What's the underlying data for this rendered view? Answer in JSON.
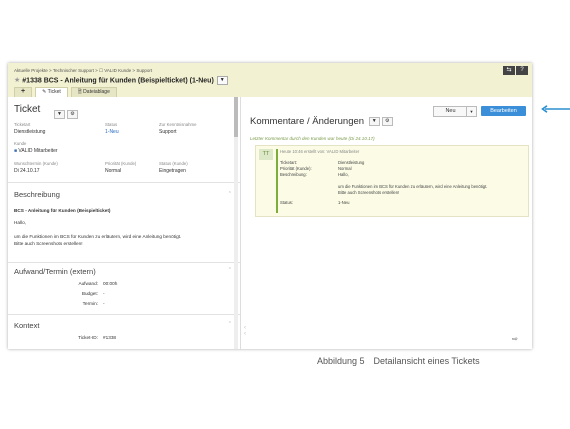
{
  "breadcrumb": "Aktuelle Projekte  >  Technischer Support  >  ☐ VALID Kunde  >  Support",
  "ticket_title": "#1338 BCS - Anleitung für Kunden (Beispielticket) (1-Neu)",
  "tabs": [
    {
      "label": "+"
    },
    {
      "label": "Ticket"
    },
    {
      "label": "Dateiablage"
    }
  ],
  "corner_buttons": [
    "⇆",
    "?"
  ],
  "left": {
    "title": "Ticket",
    "fields": {
      "ticketart_label": "Ticketart",
      "ticketart": "Dienstleistung",
      "status_label": "Status",
      "status": "1-Neu",
      "zustaendig_label": "Zur Kenntnisnahme",
      "zustaendig": "Support",
      "kunde_label": "Kunde",
      "kunde": "VALID Mitarbeiter",
      "wunschtermin_label": "Wunschtermin (Kunde)",
      "wunschtermin": "Di 24.10.17",
      "prio_label": "Priorität (Kunde)",
      "prio": "Normal",
      "status_kunde_label": "Status (Kunde)",
      "status_kunde": "Eingetragen"
    },
    "beschreibung": {
      "heading": "Beschreibung",
      "title": "BCS - Anleitung für Kunden (Beispielticket)",
      "greeting": "Hallo,",
      "line1": "um die Funktionen im BCS für Kunden zu erläutern, wird eine Anleitung benötigt.",
      "line2": "Bitte auch Screenshots erstellen!"
    },
    "aufwand": {
      "heading": "Aufwand/Termin (extern)",
      "aufwand_label": "Aufwand:",
      "aufwand": "00:00h",
      "budget_label": "Budget:",
      "budget": "-",
      "termin_label": "Termin:",
      "termin": "-"
    },
    "kontext": {
      "heading": "Kontext",
      "ticket_id_label": "Ticket-ID:",
      "ticket_id": "#1338"
    }
  },
  "right": {
    "title": "Kommentare / Änderungen",
    "neu_button": "Neu",
    "bearbeiten_button": "Bearbeiten",
    "latest_note": "Letzter Kommentar durch den Kunden war heute (Di 24.10.17)",
    "comment": {
      "avatar": "TT",
      "time": "Heute 10:46 erstellt von: VALID Mitarbeiter",
      "rows": [
        {
          "k": "Ticketart:",
          "v": "Dienstleistung"
        },
        {
          "k": "Priorität (Kunde):",
          "v": "Normal"
        },
        {
          "k": "Beschreibung:",
          "v": "Hallo,"
        }
      ],
      "desc1": "um die Funktionen im BCS für Kunden zu erläutern, wird eine Anleitung benötigt.",
      "desc2": "Bitte auch Screenshots erstellen!",
      "status_label": "Status:",
      "status": "1-Neu"
    }
  },
  "caption": {
    "number": "Abbildung 5",
    "text": "Detailansicht eines Tickets"
  },
  "colors": {
    "header_bg": "#f2f1d2",
    "accent_button": "#3b8fd8",
    "arrow": "#2a90d0",
    "comment_bar": "#7dae3c"
  }
}
